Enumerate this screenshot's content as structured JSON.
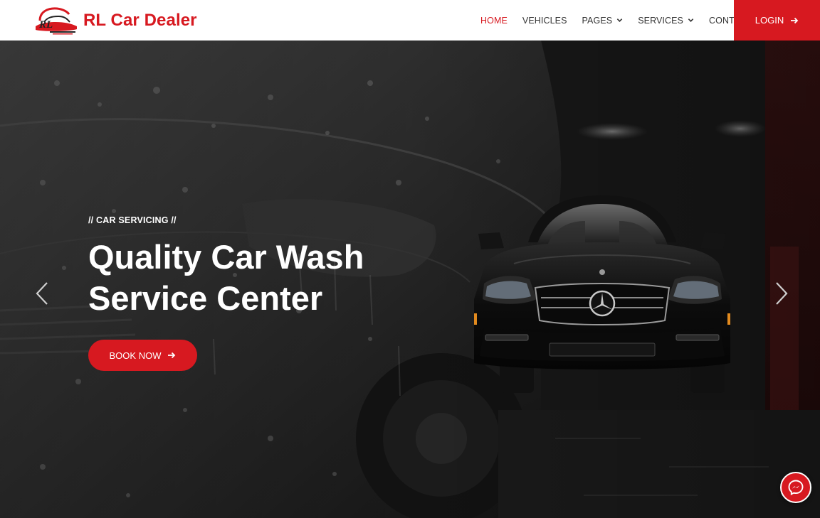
{
  "brand": {
    "name": "RL Car Dealer",
    "logo_icon": "rl-car-logo-icon",
    "logo_text": "RL"
  },
  "nav": {
    "items": [
      {
        "label": "HOME",
        "active": true,
        "dropdown": false
      },
      {
        "label": "VEHICLES",
        "active": false,
        "dropdown": false
      },
      {
        "label": "PAGES",
        "active": false,
        "dropdown": true
      },
      {
        "label": "SERVICES",
        "active": false,
        "dropdown": true
      },
      {
        "label": "CONTACT",
        "active": false,
        "dropdown": false
      }
    ],
    "login_label": "LOGIN"
  },
  "hero": {
    "eyebrow": "// CAR SERVICING //",
    "title_line1": "Quality Car Wash",
    "title_line2": "Service Center",
    "cta_label": "BOOK NOW"
  },
  "icons": {
    "prev": "chevron-left-icon",
    "next": "chevron-right-icon",
    "messenger": "messenger-icon",
    "arrow": "arrow-right-icon",
    "dropdown": "chevron-down-icon"
  },
  "colors": {
    "accent": "#d71920",
    "nav_text": "#333333",
    "white": "#ffffff"
  }
}
